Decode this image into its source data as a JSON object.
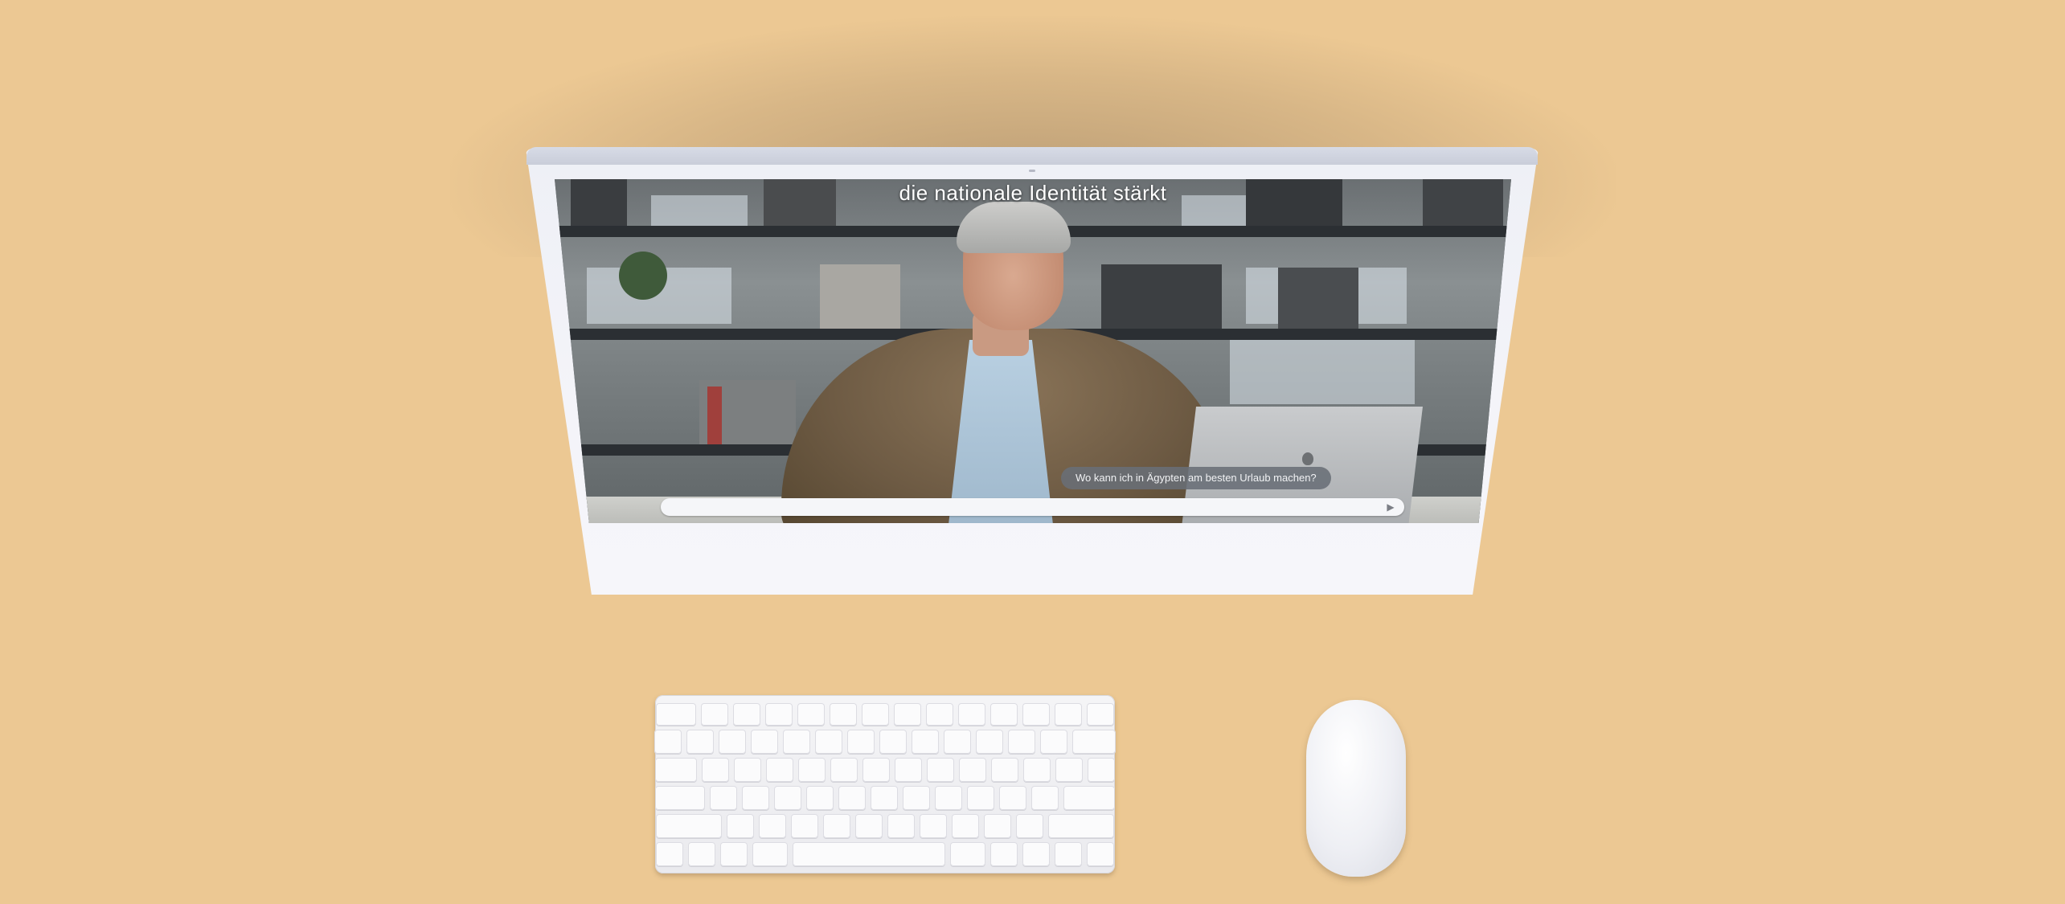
{
  "video": {
    "subtitle": "die nationale Identität stärkt"
  },
  "chat": {
    "last_message": "Wo kann ich in Ägypten am besten Urlaub machen?",
    "input_value": "",
    "send_icon": "send-icon"
  },
  "colors": {
    "background": "#ecc893",
    "device": "#f4f4f9",
    "chat_bubble": "#696e76"
  }
}
